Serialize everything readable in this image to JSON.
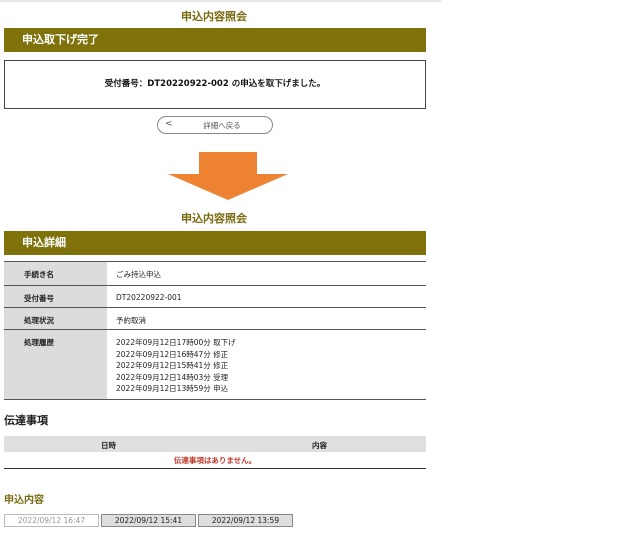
{
  "top": {
    "page_title": "申込内容照会",
    "section_title": "申込取下げ完了",
    "notice": "受付番号：DT20220922-002 の申込を取下げました。",
    "back_button": "詳細へ戻る",
    "back_chevron": "<"
  },
  "arrow_color": "#ee8233",
  "lower": {
    "page_title": "申込内容照会",
    "section_title": "申込詳細"
  },
  "details": [
    {
      "label": "手続き名",
      "value": "ごみ持込申込"
    },
    {
      "label": "受付番号",
      "value": "DT20220922-001"
    },
    {
      "label": "処理状況",
      "value": "予約取消"
    },
    {
      "label": "処理履歴",
      "history": [
        "2022年09月12日17時00分 取下げ",
        "2022年09月12日16時47分 修正",
        "2022年09月12日15時41分 修正",
        "2022年09月12日14時03分 受理",
        "2022年09月12日13時59分 申込"
      ]
    }
  ],
  "messages": {
    "heading": "伝達事項",
    "col_datetime": "日時",
    "col_content": "内容",
    "empty": "伝達事項はありません。"
  },
  "application": {
    "heading": "申込内容",
    "tabs": [
      "2022/09/12 16:47",
      "2022/09/12 15:41",
      "2022/09/12 13:59"
    ]
  }
}
